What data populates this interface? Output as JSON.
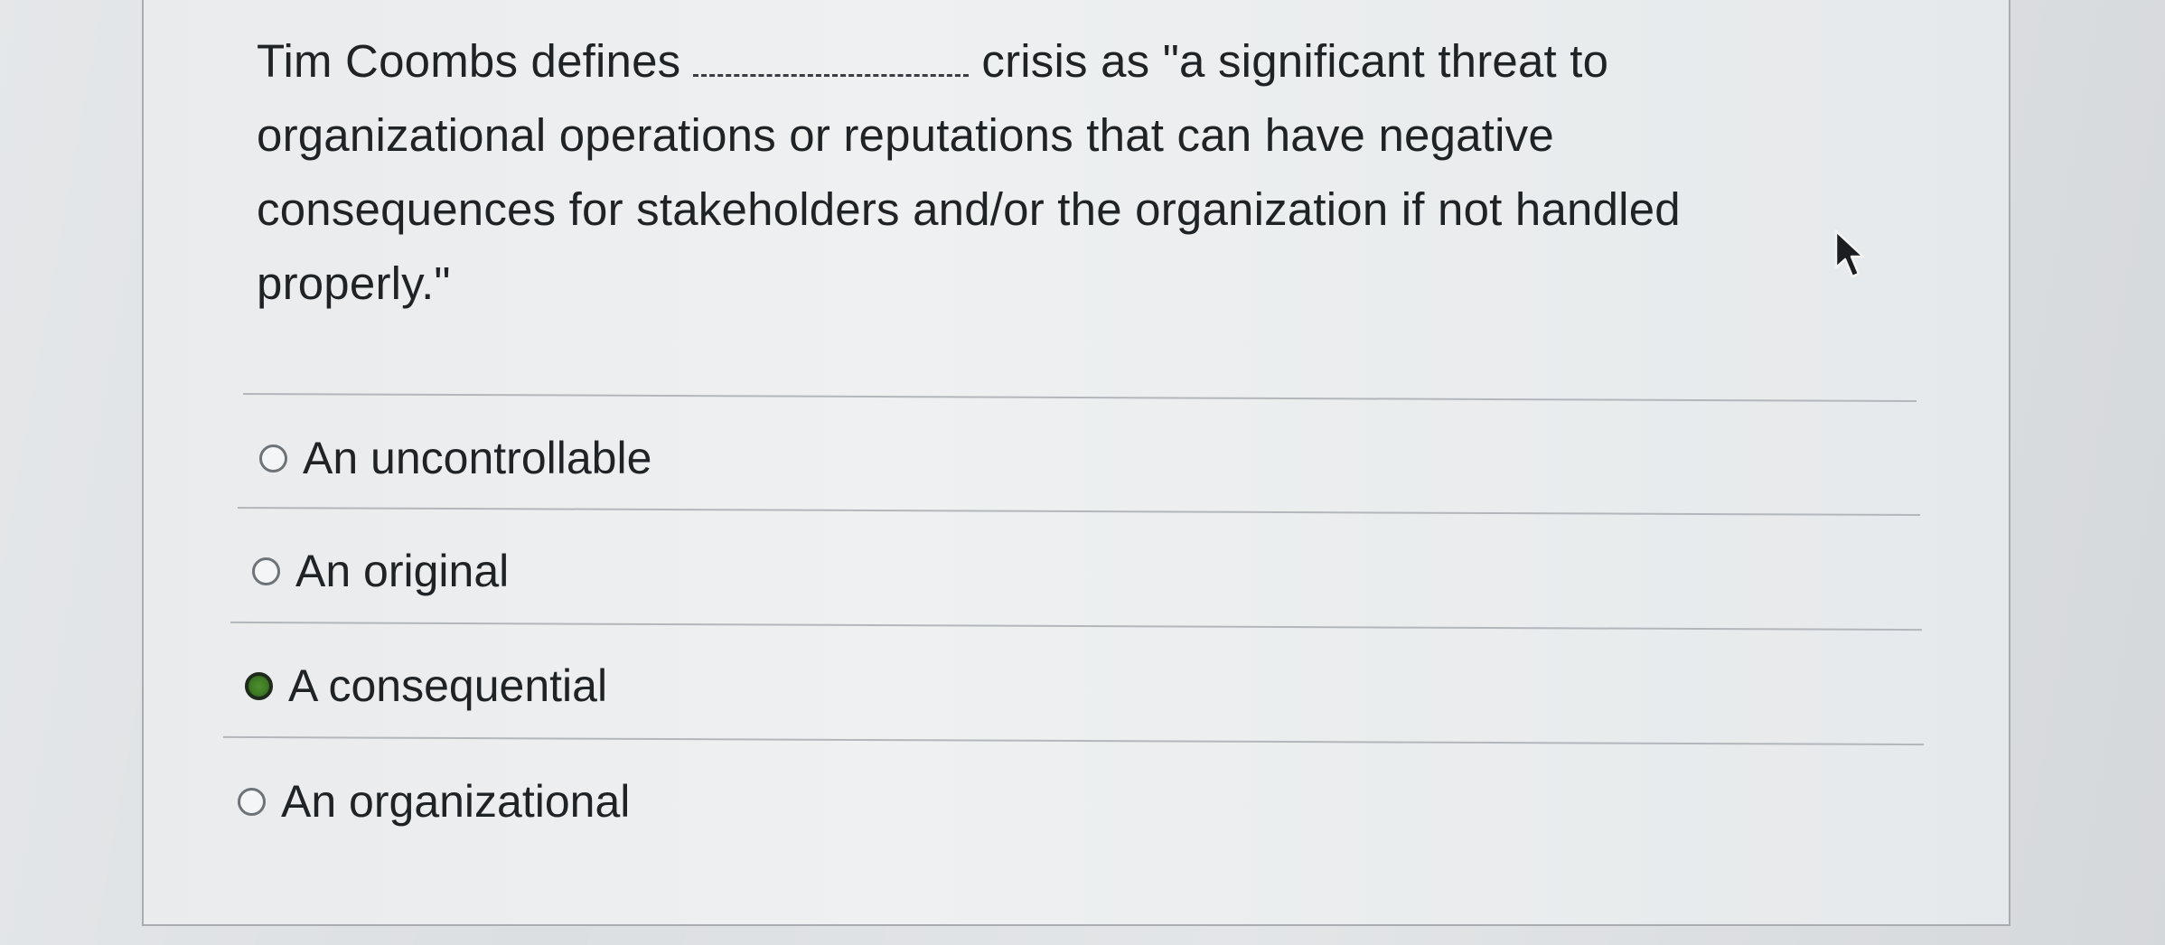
{
  "question": {
    "part1": "Tim Coombs defines",
    "part2": "crisis as \"a significant threat to",
    "line2": "organizational operations or reputations that can have negative",
    "line3": "consequences for stakeholders and/or the organization if not handled",
    "line4": "properly.\""
  },
  "options": [
    {
      "label": "An uncontrollable",
      "selected": false
    },
    {
      "label": "An original",
      "selected": false
    },
    {
      "label": "A consequential",
      "selected": true
    },
    {
      "label": "An organizational",
      "selected": false
    }
  ],
  "colors": {
    "selected_radio": "#3e7a24",
    "text": "#1f2326"
  },
  "icons": {
    "cursor": "mouse-pointer-icon"
  }
}
